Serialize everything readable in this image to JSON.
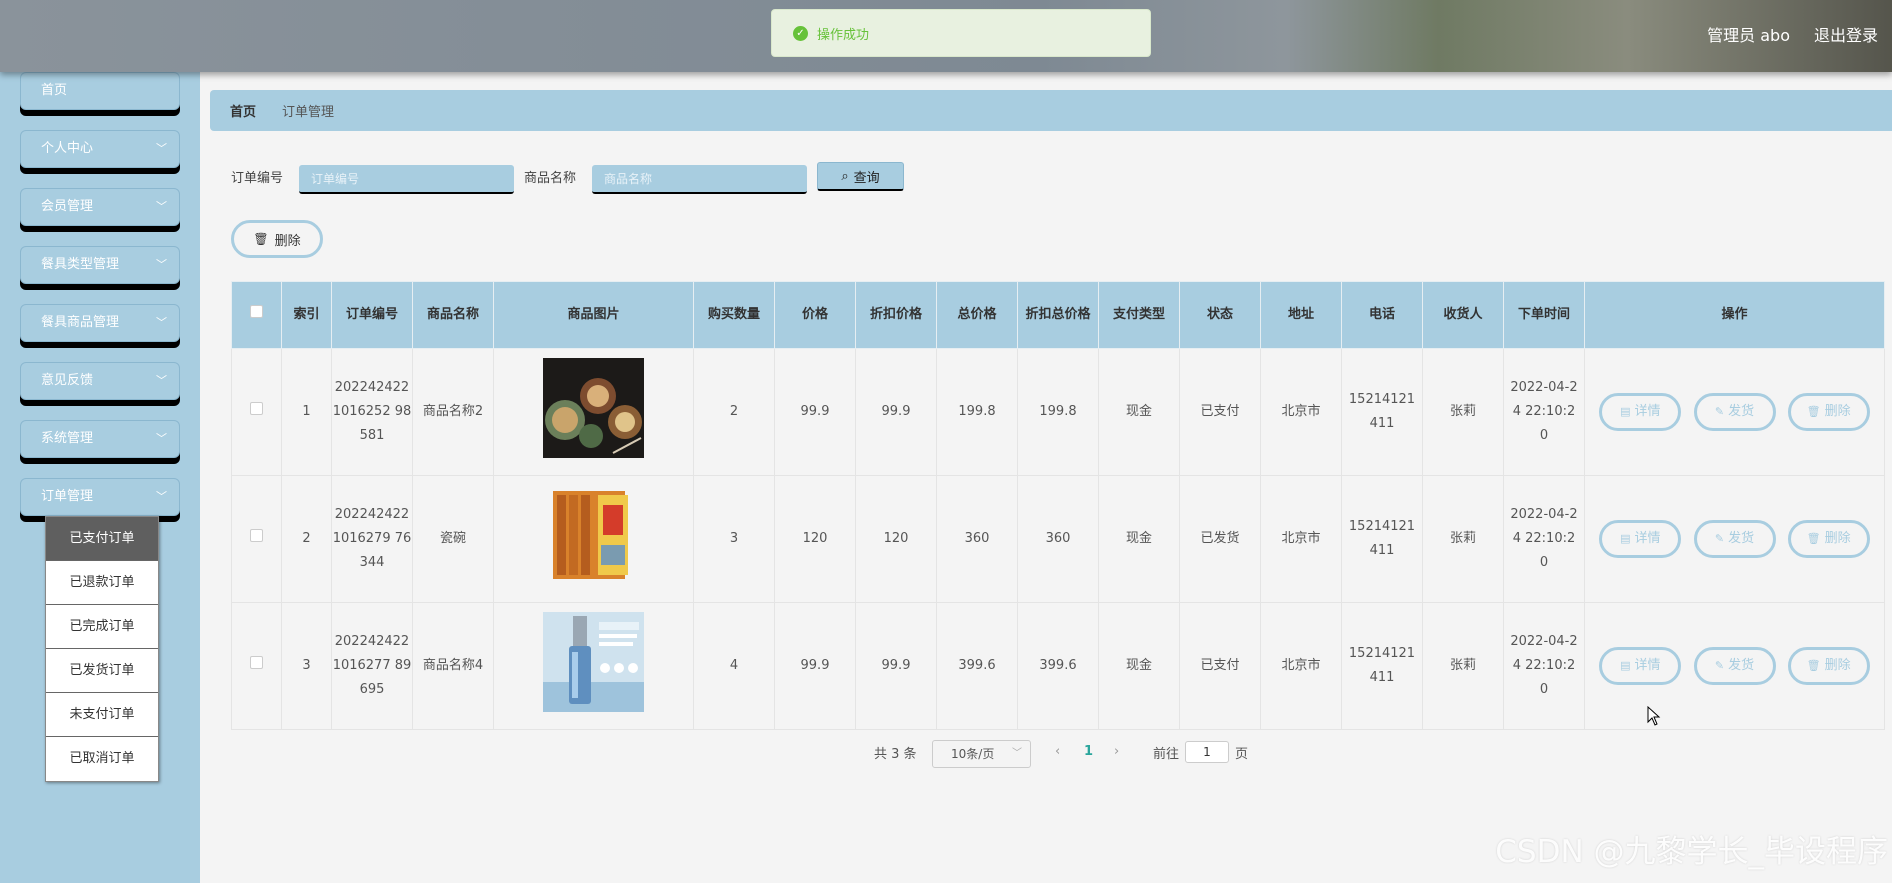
{
  "header": {
    "user_label": "管理员 abo",
    "logout_label": "退出登录"
  },
  "toast": {
    "message": "操作成功",
    "color": "#67c23a"
  },
  "sidebar": {
    "items": [
      {
        "label": "首页",
        "has_children": false
      },
      {
        "label": "个人中心",
        "has_children": true
      },
      {
        "label": "会员管理",
        "has_children": true
      },
      {
        "label": "餐具类型管理",
        "has_children": true
      },
      {
        "label": "餐具商品管理",
        "has_children": true
      },
      {
        "label": "意见反馈",
        "has_children": true
      },
      {
        "label": "系统管理",
        "has_children": true
      },
      {
        "label": "订单管理",
        "has_children": true
      }
    ],
    "submenu": [
      "已支付订单",
      "已退款订单",
      "已完成订单",
      "已发货订单",
      "未支付订单",
      "已取消订单"
    ],
    "submenu_active": "已支付订单"
  },
  "breadcrumb": {
    "home": "首页",
    "current": "订单管理"
  },
  "search": {
    "order_no_label": "订单编号",
    "order_no_placeholder": "订单编号",
    "product_label": "商品名称",
    "product_placeholder": "商品名称",
    "query_label": "查询"
  },
  "toolbar": {
    "delete_label": "删除"
  },
  "table": {
    "columns": [
      "索引",
      "订单编号",
      "商品名称",
      "商品图片",
      "购买数量",
      "价格",
      "折扣价格",
      "总价格",
      "折扣总价格",
      "支付类型",
      "状态",
      "地址",
      "电话",
      "收货人",
      "下单时间",
      "操作"
    ],
    "rows": [
      {
        "index": "1",
        "order_no": "2022424221016252 98581",
        "product": "商品名称2",
        "image": "food-bowls-image",
        "qty": "2",
        "price": "99.9",
        "discount_price": "99.9",
        "total": "199.8",
        "discount_total": "199.8",
        "pay_type": "现金",
        "status": "已支付",
        "address": "北京市",
        "phone": "15214121411",
        "receiver": "张莉",
        "time": "2022-04-24 22:10:20"
      },
      {
        "index": "2",
        "order_no": "2022424221016279 76344",
        "product": "瓷碗",
        "image": "book-set-image",
        "qty": "3",
        "price": "120",
        "discount_price": "120",
        "total": "360",
        "discount_total": "360",
        "pay_type": "现金",
        "status": "已发货",
        "address": "北京市",
        "phone": "15214121411",
        "receiver": "张莉",
        "time": "2022-04-24 22:10:20"
      },
      {
        "index": "3",
        "order_no": "2022424221016277 89695",
        "product": "商品名称4",
        "image": "serum-bottle-image",
        "qty": "4",
        "price": "99.9",
        "discount_price": "99.9",
        "total": "399.6",
        "discount_total": "399.6",
        "pay_type": "现金",
        "status": "已支付",
        "address": "北京市",
        "phone": "15214121411",
        "receiver": "张莉",
        "time": "2022-04-24 22:10:20"
      }
    ],
    "row_actions": {
      "detail": "详情",
      "ship": "发货",
      "delete": "删除"
    }
  },
  "pagination": {
    "total_label": "共 3 条",
    "page_size": "10条/页",
    "current_page": "1",
    "goto_label": "前往",
    "goto_value": "1",
    "page_suffix": "页"
  },
  "watermark": "CSDN @九黎学长_毕设程序",
  "colors": {
    "accent": "#a8cde0",
    "page_bg": "#f4f4f4",
    "pager_active": "#2aa59c"
  }
}
